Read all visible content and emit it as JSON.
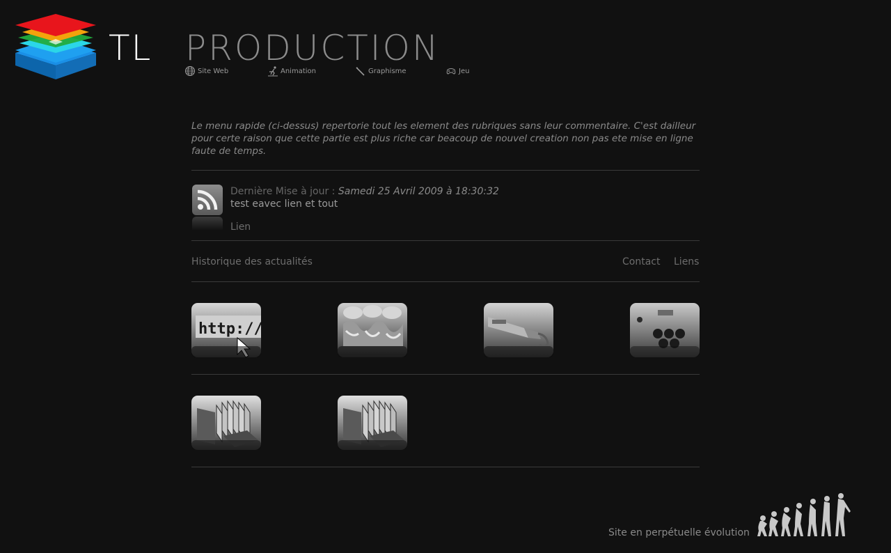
{
  "brand": {
    "prefix": "TL",
    "name": "PRODUCTION"
  },
  "quick_nav": [
    {
      "label": "Site Web",
      "icon": "globe-icon"
    },
    {
      "label": "Animation",
      "icon": "runner-icon"
    },
    {
      "label": "Graphisme",
      "icon": "pencil-icon"
    },
    {
      "label": "Jeu",
      "icon": "gamepad-icon"
    }
  ],
  "intro": "Le menu rapide (ci-dessus) repertorie tout les element des rubriques sans leur commentaire. C'est dailleur pour certe raison que cette partie est plus riche car beacoup de nouvel creation non pas ete mise en ligne faute de temps.",
  "news": {
    "icon": "rss-icon",
    "date_label": "Dernière Mise à jour :",
    "date": "Samedi 25 Avril 2009 à 18:30:32",
    "headline": "test eavec lien et tout",
    "link": "Lien"
  },
  "links": {
    "history": "Historique des actualités",
    "contact": "Contact",
    "liens": "Liens"
  },
  "thumbnails": [
    {
      "name": "site-web-thumbnail",
      "subject": "http-address-bar"
    },
    {
      "name": "animation-thumbnail",
      "subject": "clay-characters"
    },
    {
      "name": "graphisme-thumbnail",
      "subject": "paint-tube"
    },
    {
      "name": "jeu-thumbnail",
      "subject": "arcade-controller"
    },
    {
      "name": "archive-thumbnail-1",
      "subject": "books-and-binders"
    },
    {
      "name": "archive-thumbnail-2",
      "subject": "books-and-binders"
    }
  ],
  "footer": {
    "tagline": "Site en perpétuelle évolution"
  },
  "colors": {
    "background": "#111111",
    "text": "#8a8a8a",
    "logo_red": "#e8141c",
    "logo_orange": "#f5a10a",
    "logo_green": "#25b240",
    "logo_cyan": "#29d8e6",
    "logo_blue": "#1893e6"
  }
}
